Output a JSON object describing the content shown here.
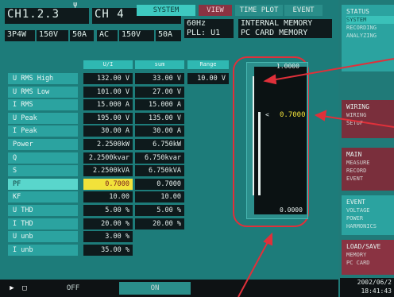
{
  "header": {
    "ch_left": "CH1.2.3",
    "ch_right": "CH 4",
    "freq": "60Hz",
    "pll": "PLL: U1",
    "mem1": "INTERNAL MEMORY",
    "mem2": "PC CARD  MEMORY",
    "wiring": "3P4W",
    "v_range": "150V",
    "a_range": "50A",
    "ac": "AC",
    "v2": "150V",
    "a2": "50A"
  },
  "tabs": [
    "SYSTEM",
    "VIEW",
    "TIME PLOT",
    "EVENT"
  ],
  "columns": [
    "U/I",
    "sum",
    "Range"
  ],
  "rows": [
    {
      "label": "U RMS High",
      "v1": "132.00 V",
      "v2": "33.00 V",
      "v3": "10.00 V"
    },
    {
      "label": "U RMS Low",
      "v1": "101.00 V",
      "v2": "27.00 V"
    },
    {
      "label": "I RMS",
      "v1": "15.000 A",
      "v2": "15.000 A"
    },
    {
      "label": "U Peak",
      "v1": "195.00 V",
      "v2": "135.00 V"
    },
    {
      "label": "I Peak",
      "v1": "30.00 A",
      "v2": "30.00 A"
    },
    {
      "label": "Power",
      "v1": "2.2500kW",
      "v2": "6.750kW"
    },
    {
      "label": "Q",
      "v1": "2.2500kvar",
      "v2": "6.750kvar"
    },
    {
      "label": "S",
      "v1": "2.2500kVA",
      "v2": "6.750kVA"
    },
    {
      "label": "PF",
      "v1": "0.7000",
      "v2": "0.7000",
      "highlight": true
    },
    {
      "label": "KF",
      "v1": "10.00",
      "v2": "10.00"
    },
    {
      "label": "U THD",
      "v1": "5.00 %",
      "v2": "5.00 %"
    },
    {
      "label": "I THD",
      "v1": "20.00 %",
      "v2": "20.00 %"
    },
    {
      "label": "U unb",
      "v1": "3.00 %"
    },
    {
      "label": "I unb",
      "v1": "35.00 %"
    }
  ],
  "gauge": {
    "top": "1.0000",
    "center": "0.7000",
    "bottom": "0.0000",
    "marker": "<",
    "level": 0.7
  },
  "right_menu": [
    {
      "id": "status",
      "title": "STATUS",
      "items": [
        "SYSTEM",
        "RECORDING",
        "ANALYZING"
      ]
    },
    {
      "id": "wiring",
      "title": "WIRING",
      "items": [
        "WIRING",
        "SETUP"
      ]
    },
    {
      "id": "main",
      "title": "MAIN",
      "items": [
        "MEASURE",
        "RECORD",
        "EVENT"
      ]
    },
    {
      "id": "event",
      "title": "EVENT",
      "items": [
        "VOLTAGE",
        "POWER",
        "HARMONICS"
      ]
    },
    {
      "id": "load",
      "title": "LOAD/SAVE",
      "items": [
        "MEMORY",
        "PC CARD"
      ]
    }
  ],
  "bottom": {
    "mode": "OFF",
    "on": "ON"
  },
  "datetime": {
    "date": "2002/06/2",
    "time": "18:41:43"
  },
  "colors": {
    "accent": "#3ec9c0",
    "highlight": "#f2e23a",
    "annotation": "#e0303a"
  }
}
